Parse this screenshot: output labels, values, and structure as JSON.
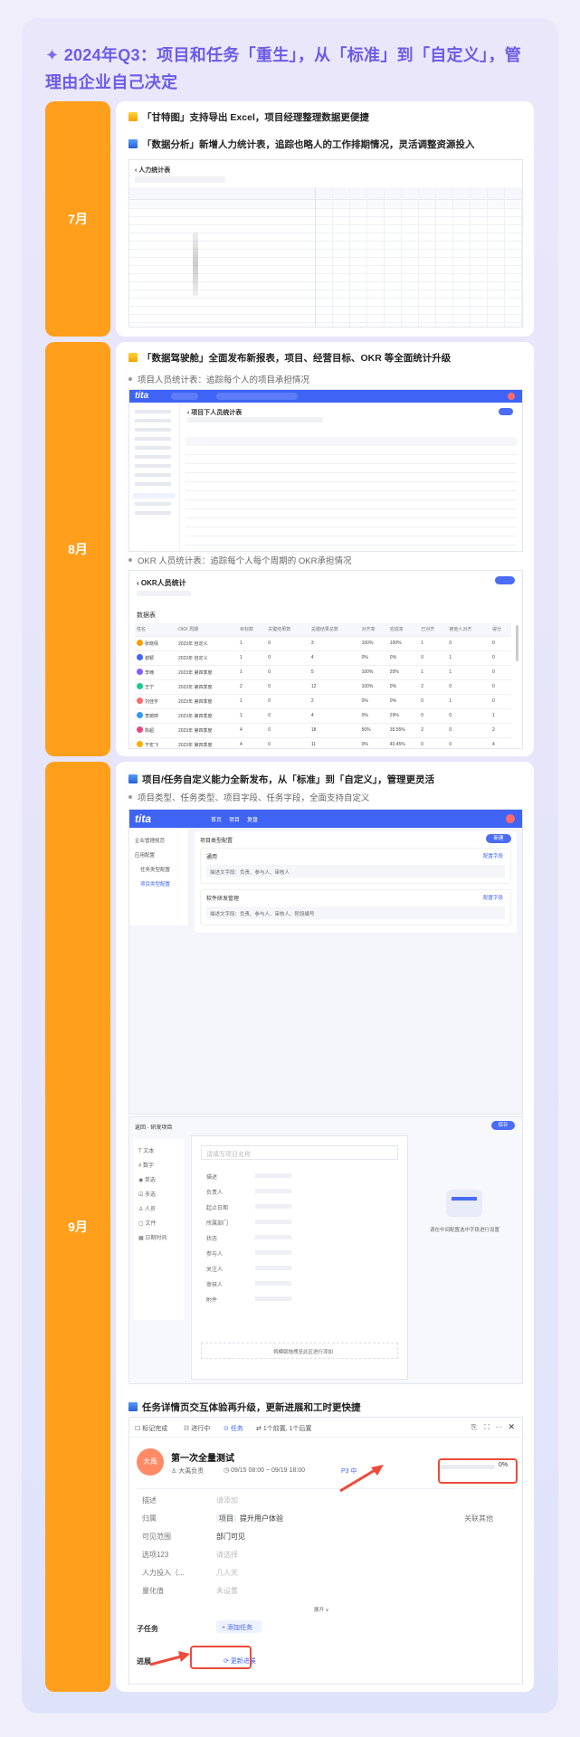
{
  "headline": "2024年Q3：项目和任务「重生」，从「标准」到「自定义」，管理由企业自己决定",
  "months": {
    "jul": {
      "label": "7月",
      "line1": "「甘特图」支持导出 Excel，项目经理整理数据更便捷",
      "line2": "「数据分析」新增人力统计表，追踪也略人的工作排期情况，灵活调整资源投入",
      "shot_title": "人力统计表"
    },
    "aug": {
      "label": "8月",
      "line1": "「数据驾驶舱」全面发布新报表，项目、经营目标、OKR 等全面统计升级",
      "sub1": "项目人员统计表：追踪每个人的项目承担情况",
      "sub2": "OKR 人员统计表：追踪每个人每个周期的 OKR承担情况",
      "shot1_title": "项目下人员统计表",
      "shot2_title": "OKR人员统计",
      "shot2_section": "数据表",
      "okr_headers": [
        "姓名",
        "OKR 周期",
        "目标数",
        "关键结果数",
        "关键结果总数",
        "对齐率",
        "完成率",
        "已对齐",
        "被他人对齐",
        "得分"
      ],
      "okr_rows": [
        [
          "张晓倩",
          "2023年 自定义",
          "1",
          "0",
          "3",
          "100%",
          "100%",
          "1",
          "0",
          "0"
        ],
        [
          "谢颖",
          "2023年 自定义",
          "1",
          "0",
          "4",
          "0%",
          "0%",
          "0",
          "1",
          "0"
        ],
        [
          "李楠",
          "2023年 第四季度",
          "1",
          "0",
          "5",
          "100%",
          "20%",
          "1",
          "1",
          "0"
        ],
        [
          "王宁",
          "2023年 第四季度",
          "2",
          "0",
          "12",
          "100%",
          "0%",
          "2",
          "0",
          "0"
        ],
        [
          "刘佳宇",
          "2023年 第四季度",
          "1",
          "0",
          "2",
          "0%",
          "0%",
          "0",
          "1",
          "0"
        ],
        [
          "李婉婷",
          "2023年 第四季度",
          "1",
          "0",
          "4",
          "0%",
          "29%",
          "0",
          "0",
          "1"
        ],
        [
          "陈超",
          "2023年 第四季度",
          "4",
          "0",
          "18",
          "50%",
          "35.55%",
          "2",
          "0",
          "2"
        ],
        [
          "于宏飞",
          "2023年 第四季度",
          "4",
          "0",
          "11",
          "0%",
          "40.45%",
          "0",
          "0",
          "4"
        ]
      ]
    },
    "sep": {
      "label": "9月",
      "line1": "项目/任务自定义能力全新发布，从「标准」到「自定义」，管理更灵活",
      "sub1": "项目类型、任务类型、项目字段、任务字段，全面支持自定义",
      "line2": "任务详情页交互体验再升级，更新进展和工时更快捷",
      "nav": [
        "首页",
        "项目",
        "复盘"
      ],
      "side": [
        "企业管理规范",
        "应用配置",
        "任务类型配置",
        "项目类型配置"
      ],
      "config_title": "项目类型配置",
      "type1": "通用",
      "type1_fields": "描述文字段：负责、参与人、审核人",
      "type2": "软件研发管理",
      "type2_fields": "描述文字段：负责、参与人、审核人、阶段编号",
      "config_btn": "配置字段",
      "create_btn": "新建",
      "editor_back": "返回",
      "editor_title": "研发项目",
      "editor_save": "保存",
      "editor_name_placeholder": "请填写项目名称",
      "field_types": [
        "文本",
        "数字",
        "单选",
        "多选",
        "人员",
        "文件",
        "日期时间"
      ],
      "editor_fields": [
        "描述",
        "负责人",
        "起止日期",
        "所属部门",
        "状态",
        "参与人",
        "关注人",
        "审核人",
        "附件"
      ],
      "editor_tip": "请在中间配置选中字段进行设置",
      "editor_footer": "将模版拖拽至此区进行添加",
      "task": {
        "toolbar": [
          "标记完成",
          "进行中",
          "任务",
          "1个前置, 1个后置"
        ],
        "avatar_text": "大禹",
        "title": "第一次全量测试",
        "owner": "大禹负责",
        "date": "09/15 08:00 ~ 09/19 18:00",
        "priority": "P3 中",
        "progress": "0%",
        "fields": [
          "描述",
          "归属",
          "可见范围",
          "选项123",
          "人力投入（...",
          "量化值"
        ],
        "values": [
          "请添加",
          "提升用户体验",
          "部门可见",
          "请选择",
          "几人天",
          "未设置"
        ],
        "value_tag": "项目",
        "link": "关联其他",
        "expand": "展开",
        "subtask_label": "子任务",
        "subtask_btn": "添加任务",
        "progress_label": "进展",
        "progress_btn": "更新进展"
      }
    }
  },
  "colors": {
    "accent": "#6c5ce7",
    "orange": "#ff9f1c",
    "blue": "#3f64f5",
    "red": "#ee4a3a"
  }
}
